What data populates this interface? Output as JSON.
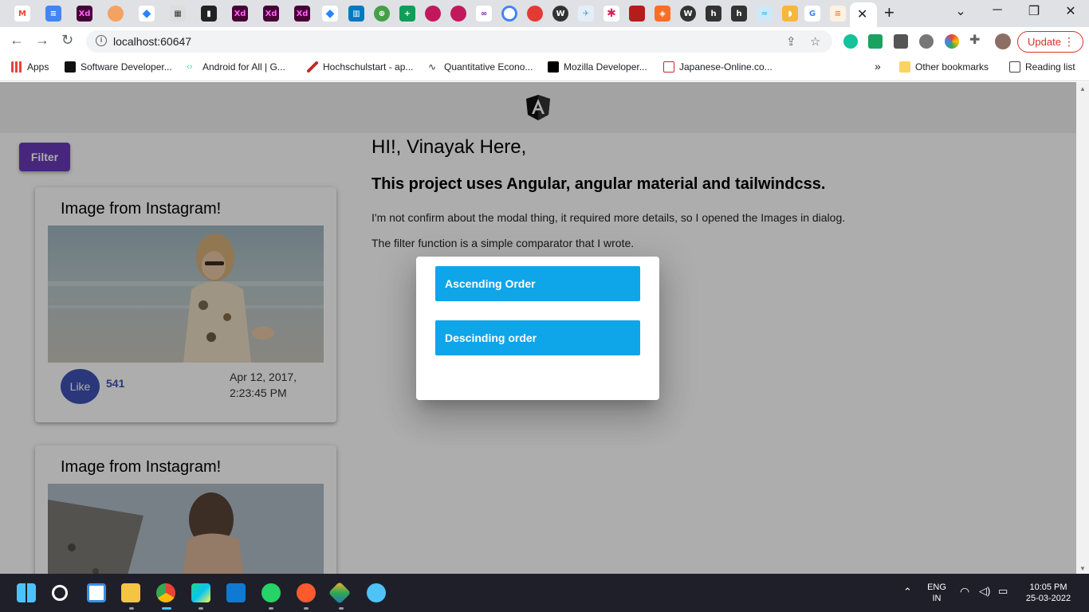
{
  "browser": {
    "tab_close_glyph": "✕",
    "new_tab_glyph": "+",
    "url": "localhost:60647",
    "update_label": "Update",
    "bookmarks": [
      {
        "label": "Apps",
        "icon": "apps-grid-icon"
      },
      {
        "label": "Software Developer...",
        "icon": "t-icon"
      },
      {
        "label": "Android for All | G...",
        "icon": "android-icon"
      },
      {
        "label": "Hochschulstart - ap...",
        "icon": "hochschulstart-icon"
      },
      {
        "label": "Quantitative Econo...",
        "icon": "pulse-icon"
      },
      {
        "label": "Mozilla Developer...",
        "icon": "mdn-icon"
      },
      {
        "label": "Japanese-Online.co...",
        "icon": "jp-icon"
      }
    ],
    "bookmarks_overflow": "»",
    "other_bookmarks": "Other bookmarks",
    "reading_list": "Reading list"
  },
  "page": {
    "filter_label": "Filter",
    "intro": {
      "heading": "HI!, Vinayak Here,",
      "subheading": "This project uses Angular, angular material and tailwindcss.",
      "paragraph1": "I'm not confirm about the modal thing, it required more details, so I opened the Images in dialog.",
      "paragraph2": "The filter function is a simple comparator that I wrote."
    },
    "cards": [
      {
        "title": "Image from Instagram!",
        "like_label": "Like",
        "likes": "541",
        "date_line1": "Apr 12, 2017,",
        "date_line2": "2:23:45 PM"
      },
      {
        "title": "Image from Instagram!"
      }
    ]
  },
  "dialog": {
    "ascending_label": "Ascending Order",
    "descending_label": "Descinding order"
  },
  "taskbar": {
    "language_line1": "ENG",
    "language_line2": "IN",
    "time": "10:05 PM",
    "date": "25-03-2022"
  },
  "colors": {
    "filter_button": "#673ab7",
    "like_button": "#3f51b5",
    "sort_button": "#0ea5e9",
    "update_button": "#d93025"
  }
}
